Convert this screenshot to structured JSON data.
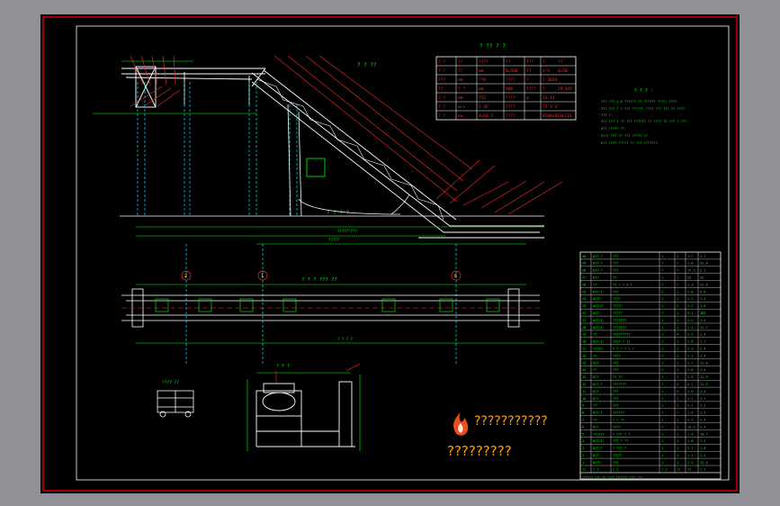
{
  "colors": {
    "frame": "#ff0000",
    "struct": "#ffffff",
    "green": "#00ff00",
    "red": "#ff2a2a",
    "cyan": "#00e5ff",
    "yellow": "#ffff00",
    "accent": "#f0a020"
  },
  "titles": {
    "top_view": "? ? ??",
    "ground": "? ? ? ?",
    "plan_view": "? ? ? ??? ??",
    "section": "? ? ?",
    "detail": "???? ??"
  },
  "grid_labels": [
    "2",
    "1",
    "6"
  ],
  "param_table": {
    "title": "? ?? ? ?",
    "header": [
      "? ?",
      "??",
      "????",
      "??",
      "???",
      "?",
      "??"
    ],
    "rows": [
      [
        "? ?",
        "??",
        "mm",
        "B=500",
        "??",
        "t/h",
        "Q=50"
      ],
      [
        "???",
        "mm",
        "??8",
        "????",
        "?",
        "1:3034"
      ],
      [
        "??",
        "? ?",
        "mm",
        "900",
        "????",
        "?",
        "29.445"
      ],
      [
        "? ?",
        "mm",
        "752",
        "????",
        "m",
        "33.14"
      ],
      [
        "? ?",
        "m/s",
        "1.45",
        "????",
        "",
        "?2°3'3'"
      ],
      [
        "? ?",
        "kw",
        "4x10.5",
        "????",
        "",
        "B500x810x133"
      ]
    ]
  },
  "notes": {
    "title": "? ? ? :",
    "lines": [
      "1?? ??? 1.0 ?????? ?? ?????? ????, ????.",
      "2?? ??? ? ? ??? ?????? ???? ??? ??? ?? ????",
      "  ??? ?.",
      "3?? ??? ? ?? ??? ?????? ?? ???? ?? ??? ? ???.",
      "4?? ????? ??.",
      "5??? ??? ?? ??? ????? ??.",
      "6?? ???? ????? ?? ??? ???????."
    ]
  },
  "bom": {
    "rows": [
      [
        "30",
        "DJ?-?",
        "???",
        "1",
        "1",
        "1.7",
        "1.7"
      ],
      [
        "29",
        "DJ?-?",
        "???",
        "?",
        "?",
        "1.8",
        "31.4"
      ],
      [
        "28",
        "DJ?-?",
        "???",
        "?",
        "?",
        "17.2",
        "2.2"
      ],
      [
        "27",
        "DJ?",
        "??",
        "1",
        "1",
        "22",
        "22"
      ],
      [
        "26",
        "??",
        "?? ? ? 5-?",
        "?",
        "?",
        "1.3",
        "21.4"
      ],
      [
        "25",
        "DJ?-1",
        "???",
        "2",
        "1",
        "2.8",
        "5.6"
      ],
      [
        "24",
        "DJ??",
        "????",
        "1",
        "1",
        "1.2",
        "1.2"
      ],
      [
        "23",
        "DJ?-2",
        "?????",
        "1",
        "2",
        "3.2",
        "1.6"
      ],
      [
        "22",
        "DJ?",
        "?????",
        "?",
        "1",
        "5.1",
        "103"
      ],
      [
        "21",
        "DJ?-1",
        "???????",
        "1",
        "1",
        "2.2",
        "1.4"
      ],
      [
        "20",
        "DJ?-1",
        "???????",
        "1",
        "1",
        "1.1",
        "11.7"
      ],
      [
        "19",
        "??",
        "?????????",
        "1",
        "4",
        "3.5",
        "1.4"
      ],
      [
        "18",
        "DJ?-1",
        "??1?-? 11",
        "1",
        "1",
        "1.8",
        "1.7"
      ],
      [
        "17",
        "?????",
        "? ? ? ? ? ?",
        "1",
        "1",
        "2.3",
        "2.4"
      ],
      [
        "16",
        "??",
        "????",
        "?",
        "1",
        "1.1",
        "1.4"
      ],
      [
        "15",
        "DJ?",
        "???",
        "1",
        "1",
        "1.7",
        "11.4"
      ],
      [
        "14",
        "??",
        "???",
        "2",
        "1",
        "2.8",
        "1.4"
      ],
      [
        "13",
        "DJ?",
        "?? ??",
        "1",
        "1",
        "1.5",
        "11.9"
      ],
      [
        "12",
        "DJ?-?",
        "???????",
        "?",
        "4",
        "4.1",
        "11.5"
      ],
      [
        "11",
        "DJ?",
        "???",
        "1",
        "3",
        "1.0",
        "1.4"
      ],
      [
        "10",
        "DJ?",
        "???",
        "?",
        "1",
        "1.1",
        "1.7"
      ],
      [
        "9",
        "??",
        "???",
        "1",
        "1",
        "2.2",
        "1.2"
      ],
      [
        "8",
        "DJ?-1",
        "??????",
        "?",
        "?",
        "1.4",
        "1.5"
      ],
      [
        "7",
        "??",
        "? ? ??",
        "1",
        "1",
        "2.3",
        "1.4"
      ],
      [
        "6",
        "DJ?",
        "????",
        "?",
        "1",
        "13.2",
        "1.4"
      ],
      [
        "5",
        "??/???",
        "? ??? ? ?",
        "1",
        "1",
        "1.4",
        "19.7"
      ],
      [
        "4",
        "DJ?-1",
        "??? ? ??",
        "1",
        "1",
        "1.8",
        "1.4"
      ],
      [
        "3",
        "DJ?-?",
        "? ??? ?",
        "1",
        "1",
        "3.1",
        "1.8"
      ],
      [
        "2",
        "DJ?",
        "?????",
        "1",
        "1",
        "1.1",
        "1.4"
      ],
      [
        "1",
        "DJ??",
        "???",
        "1",
        "1",
        "2.2",
        "12.4"
      ],
      [
        "??",
        "? ?",
        "? ?",
        "? ?",
        "??",
        "??",
        "? ?"
      ]
    ],
    "footer": "???????    ??? ??? ????    ??????? ???? ???"
  },
  "dimension_labels": [
    "?????",
    "?????????",
    "? ? ? ?",
    "????",
    "????",
    "????? ???"
  ],
  "watermark": {
    "line1": "???????????",
    "line2": "?????????"
  }
}
